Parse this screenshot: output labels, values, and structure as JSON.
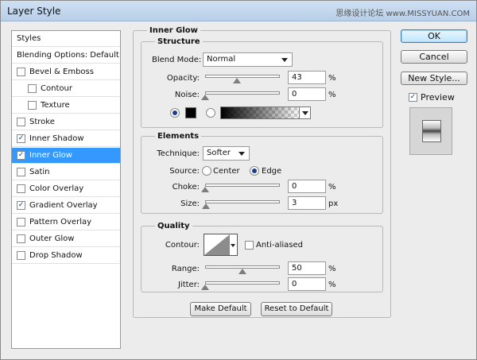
{
  "window": {
    "title": "Layer Style",
    "watermark": "思缘设计论坛 www.MISSYUAN.COM",
    "close_glyph": "✕"
  },
  "left_list": {
    "items": [
      {
        "label": "Styles",
        "checkbox": false,
        "checked": false,
        "indent": false,
        "selected": false
      },
      {
        "label": "Blending Options: Default",
        "checkbox": false,
        "checked": false,
        "indent": false,
        "selected": false
      },
      {
        "label": "Bevel & Emboss",
        "checkbox": true,
        "checked": false,
        "indent": false,
        "selected": false
      },
      {
        "label": "Contour",
        "checkbox": true,
        "checked": false,
        "indent": true,
        "selected": false
      },
      {
        "label": "Texture",
        "checkbox": true,
        "checked": false,
        "indent": true,
        "selected": false
      },
      {
        "label": "Stroke",
        "checkbox": true,
        "checked": false,
        "indent": false,
        "selected": false
      },
      {
        "label": "Inner Shadow",
        "checkbox": true,
        "checked": true,
        "indent": false,
        "selected": false
      },
      {
        "label": "Inner Glow",
        "checkbox": true,
        "checked": true,
        "indent": false,
        "selected": true
      },
      {
        "label": "Satin",
        "checkbox": true,
        "checked": false,
        "indent": false,
        "selected": false
      },
      {
        "label": "Color Overlay",
        "checkbox": true,
        "checked": false,
        "indent": false,
        "selected": false
      },
      {
        "label": "Gradient Overlay",
        "checkbox": true,
        "checked": true,
        "indent": false,
        "selected": false
      },
      {
        "label": "Pattern Overlay",
        "checkbox": true,
        "checked": false,
        "indent": false,
        "selected": false
      },
      {
        "label": "Outer Glow",
        "checkbox": true,
        "checked": false,
        "indent": false,
        "selected": false
      },
      {
        "label": "Drop Shadow",
        "checkbox": true,
        "checked": false,
        "indent": false,
        "selected": false
      }
    ],
    "check_glyph": "✓"
  },
  "inner_glow": {
    "title": "Inner Glow",
    "structure": {
      "title": "Structure",
      "blend_mode_label": "Blend Mode:",
      "blend_mode_value": "Normal",
      "opacity_label": "Opacity:",
      "opacity_value": "43",
      "opacity_fraction": 0.43,
      "noise_label": "Noise:",
      "noise_value": "0",
      "noise_fraction": 0,
      "percent": "%"
    },
    "elements": {
      "title": "Elements",
      "technique_label": "Technique:",
      "technique_value": "Softer",
      "source_label": "Source:",
      "source_center": "Center",
      "source_edge": "Edge",
      "choke_label": "Choke:",
      "choke_value": "0",
      "choke_fraction": 0,
      "size_label": "Size:",
      "size_value": "3",
      "size_fraction": 0.012,
      "percent": "%",
      "px": "px"
    },
    "quality": {
      "title": "Quality",
      "contour_label": "Contour:",
      "anti_aliased_label": "Anti-aliased",
      "range_label": "Range:",
      "range_value": "50",
      "range_fraction": 0.5,
      "jitter_label": "Jitter:",
      "jitter_value": "0",
      "jitter_fraction": 0,
      "percent": "%"
    },
    "buttons": {
      "make_default": "Make Default",
      "reset_default": "Reset to Default"
    }
  },
  "right_panel": {
    "ok": "OK",
    "cancel": "Cancel",
    "new_style": "New Style...",
    "preview_label": "Preview",
    "preview_checked": true
  },
  "colors": {
    "selected_bg": "#3399ff",
    "glow_color": "#000000"
  }
}
